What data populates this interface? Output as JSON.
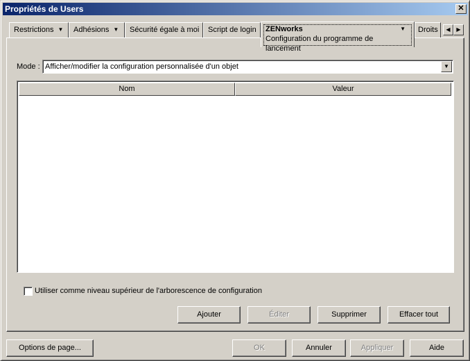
{
  "window": {
    "title": "Propriétés de Users",
    "close_glyph": "✕"
  },
  "tabs": [
    {
      "label": "Restrictions",
      "has_menu": true
    },
    {
      "label": "Adhésions",
      "has_menu": true
    },
    {
      "label": "Sécurité égale à moi",
      "has_menu": false
    },
    {
      "label": "Script de login",
      "has_menu": false
    },
    {
      "label": "ZENworks",
      "subtitle": "Configuration du programme de lancement",
      "has_menu": true,
      "active": true
    },
    {
      "label": "Droits",
      "has_menu": false
    }
  ],
  "tab_scroll": {
    "left_glyph": "◀",
    "right_glyph": "▶"
  },
  "mode": {
    "label": "Mode :",
    "value": "Afficher/modifier la configuration personnalisée d'un objet",
    "dropdown_glyph": "▼"
  },
  "table": {
    "columns": [
      "Nom",
      "Valeur"
    ],
    "rows": []
  },
  "checkbox": {
    "label": "Utiliser comme niveau supérieur de l'arborescence de configuration",
    "checked": false
  },
  "actions": {
    "add": "Ajouter",
    "edit": "Éditer",
    "delete": "Supprimer",
    "clear_all": "Effacer tout"
  },
  "footer": {
    "page_options": "Options de page...",
    "ok": "OK",
    "cancel": "Annuler",
    "apply": "Appliquer",
    "help": "Aide"
  },
  "icons": {
    "menu_arrow": "▼"
  },
  "colors": {
    "title_start": "#0a246a",
    "title_end": "#a6caf0",
    "face": "#d4d0c8"
  }
}
